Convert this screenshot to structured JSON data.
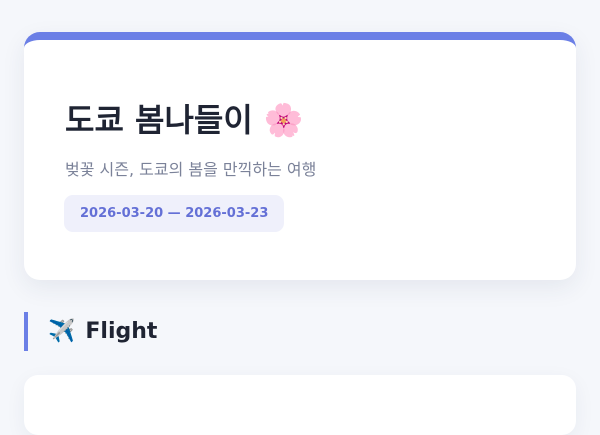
{
  "trip": {
    "title": "도쿄 봄나들이",
    "title_icon": "🌸",
    "subtitle": "벚꽃 시즌, 도쿄의 봄을 만끽하는 여행",
    "date_range": "2026-03-20 — 2026-03-23"
  },
  "sections": {
    "flight": {
      "icon": "✈️",
      "title": "Flight"
    }
  },
  "colors": {
    "accent": "#6b7fe6",
    "badge_bg": "#eff0fb",
    "badge_text": "#6470d6",
    "page_bg": "#f5f7fb"
  }
}
